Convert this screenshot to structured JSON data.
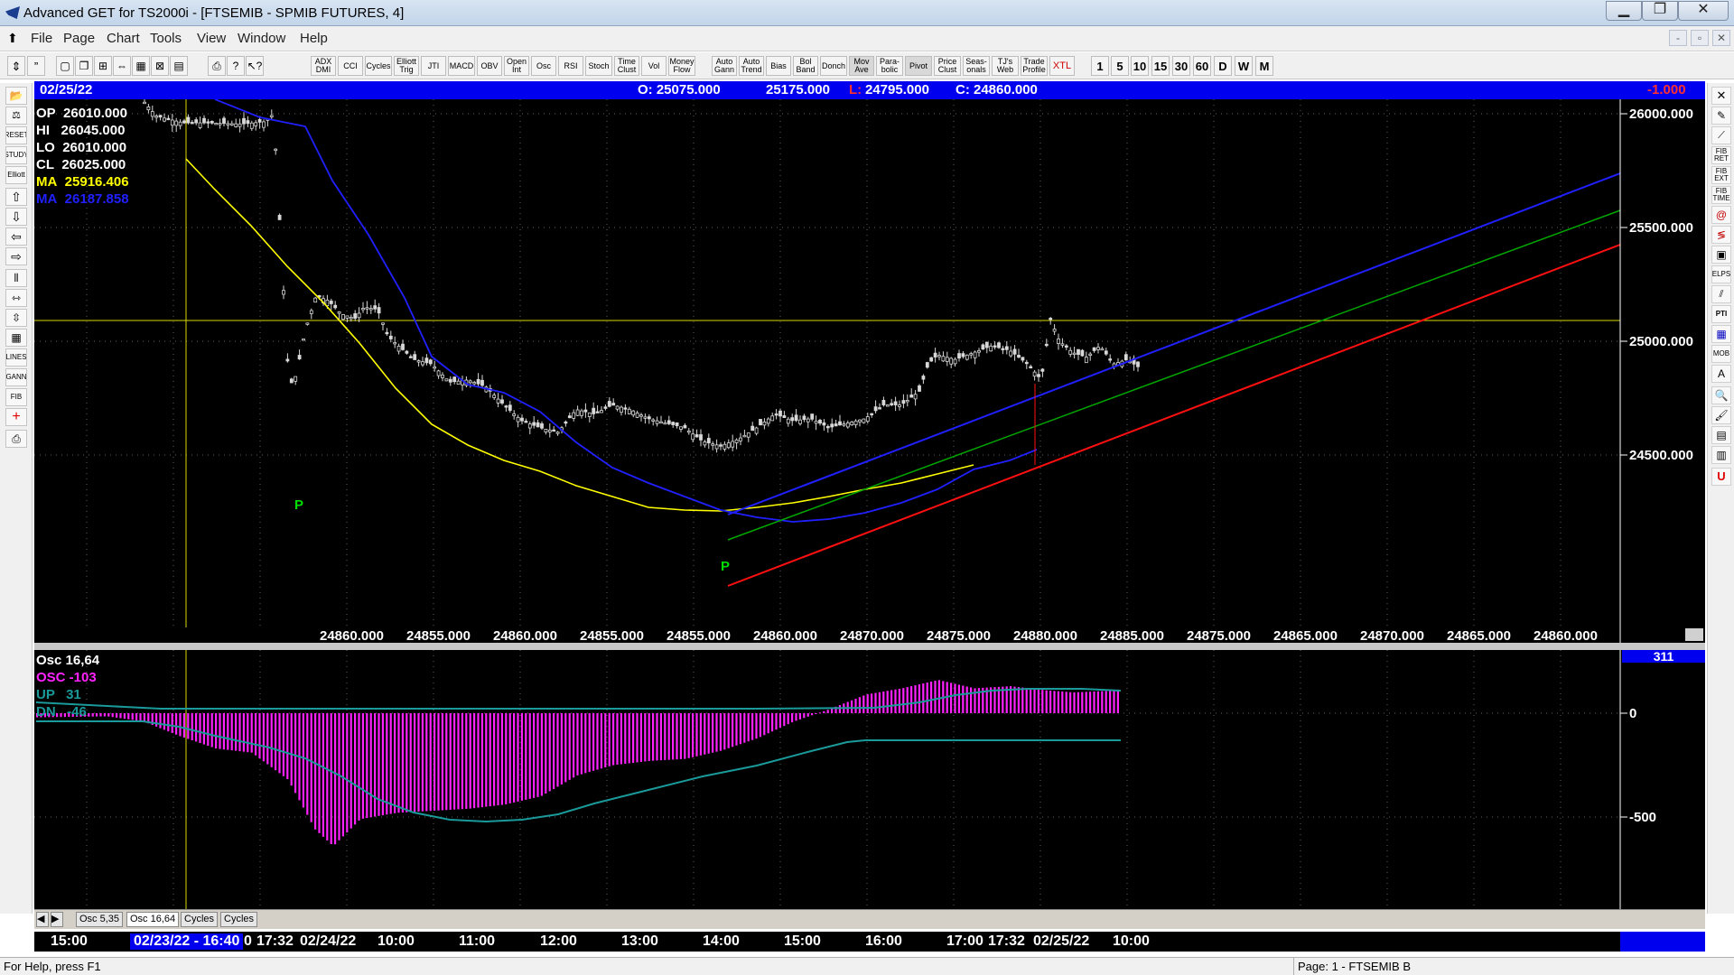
{
  "window": {
    "title": "Advanced GET for TS2000i - [FTSEMIB - SPMIB FUTURES, 4]",
    "minimize": "▁",
    "maximize": "❐",
    "close": "✕"
  },
  "menu": {
    "items": [
      "File",
      "Page",
      "Chart",
      "Tools",
      "View",
      "Window",
      "Help"
    ],
    "mdi": [
      "-",
      "▫",
      "✕"
    ]
  },
  "toolbar": {
    "file_icons": [
      "new-icon",
      "open-icon",
      "save-icon",
      "print-icon",
      "help-icon"
    ],
    "studies": [
      "ADX DMI",
      "CCI",
      "Cycles",
      "Elliott Trig",
      "JTI",
      "MACD",
      "OBV",
      "Open Int",
      "Osc",
      "RSI",
      "Stoch",
      "Time Clust",
      "Vol",
      "Money Flow",
      "Auto Gann",
      "Auto Trend",
      "Bias",
      "Bol Band",
      "Donch",
      "Mov Ave",
      "Para-bolic",
      "Pivot",
      "Price Clust",
      "Seas-onals",
      "TJ's Web",
      "Trade Profile",
      "XTL"
    ],
    "periods": [
      "1",
      "5",
      "10",
      "15",
      "30",
      "60",
      "D",
      "W",
      "M"
    ]
  },
  "infobar": {
    "date": "02/25/22",
    "open": "O: 25075.000",
    "high": "25175.000",
    "low_label": "L:",
    "low": "24795.000",
    "close": "C: 24860.000",
    "change": "-1.000"
  },
  "colors": {
    "accent": "#0000ee",
    "ma_yellow": "#ffff00",
    "ma_blue": "#2020ff",
    "trend_green": "#00b000",
    "trend_red": "#ff1010",
    "osc": "#ff22ff",
    "updn": "#1a9a9a",
    "pivot": "#00dd00"
  },
  "readout": {
    "op_label": "OP",
    "op": "26010.000",
    "hi_label": "HI",
    "hi": "26045.000",
    "lo_label": "LO",
    "lo": "26010.000",
    "cl_label": "CL",
    "cl": "26025.000",
    "ma1_label": "MA",
    "ma1": "25916.406",
    "ma2_label": "MA",
    "ma2": "26187.858"
  },
  "chart_data": [
    {
      "type": "candlestick",
      "yaxis_ticks": [
        "26000.000",
        "25500.000",
        "25000.000",
        "24500.000"
      ],
      "y_ticks_values": [
        26000,
        25500,
        25000,
        24500
      ],
      "pivots": [
        "P",
        "P"
      ],
      "bottom_price_labels": [
        "24860.000",
        "24855.000",
        "24860.000",
        "24855.000",
        "24855.000",
        "24860.000",
        "24870.000",
        "24875.000",
        "24880.000",
        "24885.000",
        "24875.000",
        "24865.000",
        "24870.000",
        "24865.000",
        "24860.000"
      ],
      "grid": true
    },
    {
      "type": "histogram",
      "title": "Osc 16,64",
      "osc_label": "OSC -103",
      "up_label": "UP   31",
      "dn_label": "DN   -46",
      "last_value": "311",
      "yaxis_ticks": [
        "0",
        "-500"
      ],
      "y_ticks_values": [
        0,
        -500
      ]
    }
  ],
  "tabs": [
    "Osc 5,35",
    "Osc 16,64",
    "Cycles",
    "Cycles"
  ],
  "timebar": {
    "labels": [
      "15:00",
      "02/23/22 - 16:40",
      "0",
      "17:32",
      "02/24/22",
      "10:00",
      "11:00",
      "12:00",
      "13:00",
      "14:00",
      "15:00",
      "16:00",
      "17:00",
      "17:32",
      "02/25/22",
      "10:00"
    ]
  },
  "status": {
    "help": "For Help, press F1",
    "page": "Page: 1 - FTSEMIB B"
  }
}
